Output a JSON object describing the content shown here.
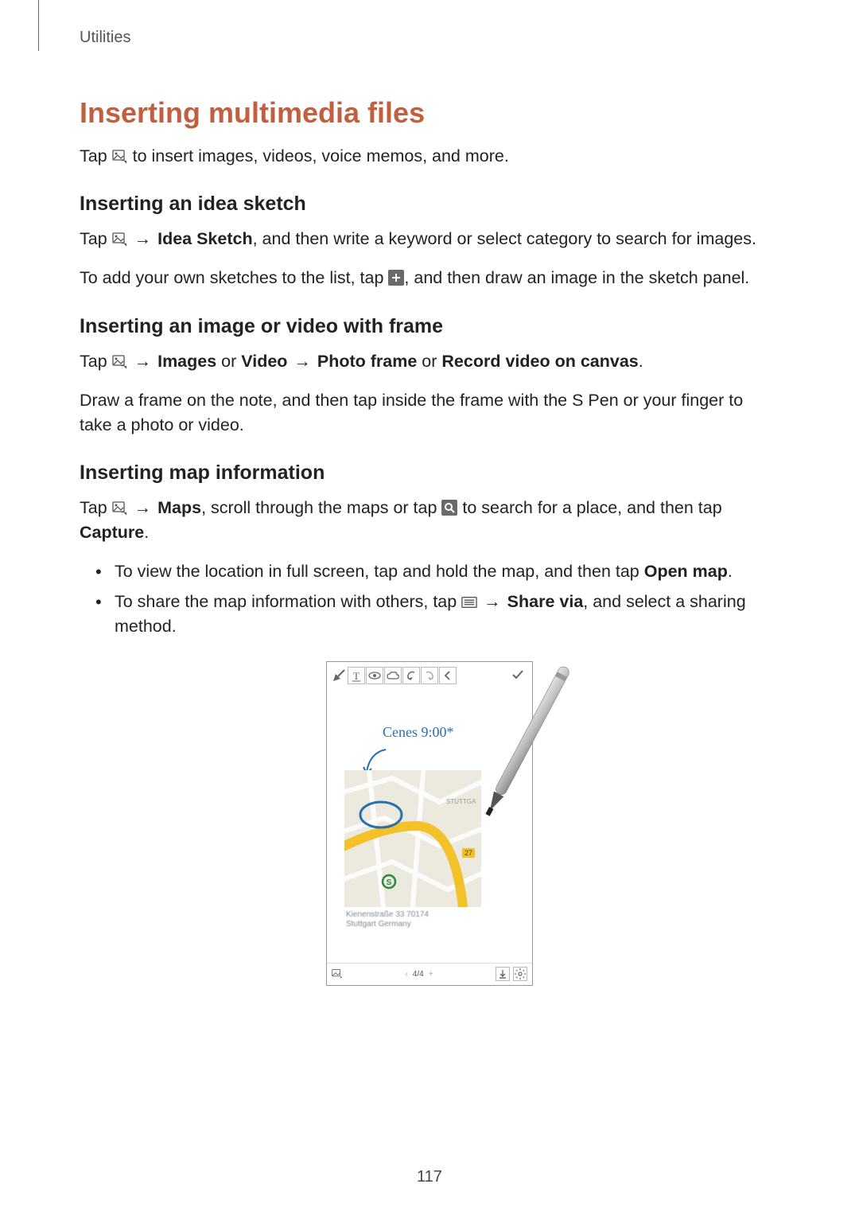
{
  "header": {
    "running": "Utilities"
  },
  "h1": "Inserting multimedia files",
  "intro": {
    "pre": "Tap ",
    "post": " to insert images, videos, voice memos, and more."
  },
  "sec1": {
    "title": "Inserting an idea sketch",
    "p1": {
      "pre": "Tap ",
      "arrow": " → ",
      "bold": "Idea Sketch",
      "post": ", and then write a keyword or select category to search for images."
    },
    "p2": {
      "pre": "To add your own sketches to the list, tap ",
      "post": ", and then draw an image in the sketch panel."
    }
  },
  "sec2": {
    "title": "Inserting an image or video with frame",
    "p1": {
      "pre": "Tap ",
      "arrow1": " → ",
      "bold1": "Images",
      "or1": " or ",
      "bold2": "Video",
      "arrow2": " → ",
      "bold3": "Photo frame",
      "or2": " or ",
      "bold4": "Record video on canvas",
      "period": "."
    },
    "p2": "Draw a frame on the note, and then tap inside the frame with the S Pen or your finger to take a photo or video."
  },
  "sec3": {
    "title": "Inserting map information",
    "p1": {
      "pre": "Tap ",
      "arrow": " → ",
      "bold1": "Maps",
      "mid1": ", scroll through the maps or tap ",
      "mid2": " to search for a place, and then tap ",
      "bold2": "Capture",
      "period": "."
    },
    "bullet1": {
      "pre": "To view the location in full screen, tap and hold the map, and then tap ",
      "bold": "Open map",
      "post": "."
    },
    "bullet2": {
      "pre": "To share the map information with others, tap ",
      "arrow": " → ",
      "bold": "Share via",
      "post": ", and select a sharing method."
    }
  },
  "figure": {
    "handwriting": "Cenes 9:00*",
    "map_badge": "27",
    "addr_line1": "Kienenstraße 33 70174",
    "addr_line2": "Stuttgart Germany",
    "pager_prev": "‹",
    "pager_text": "4/4",
    "pager_plus": "+"
  },
  "page_number": "117"
}
